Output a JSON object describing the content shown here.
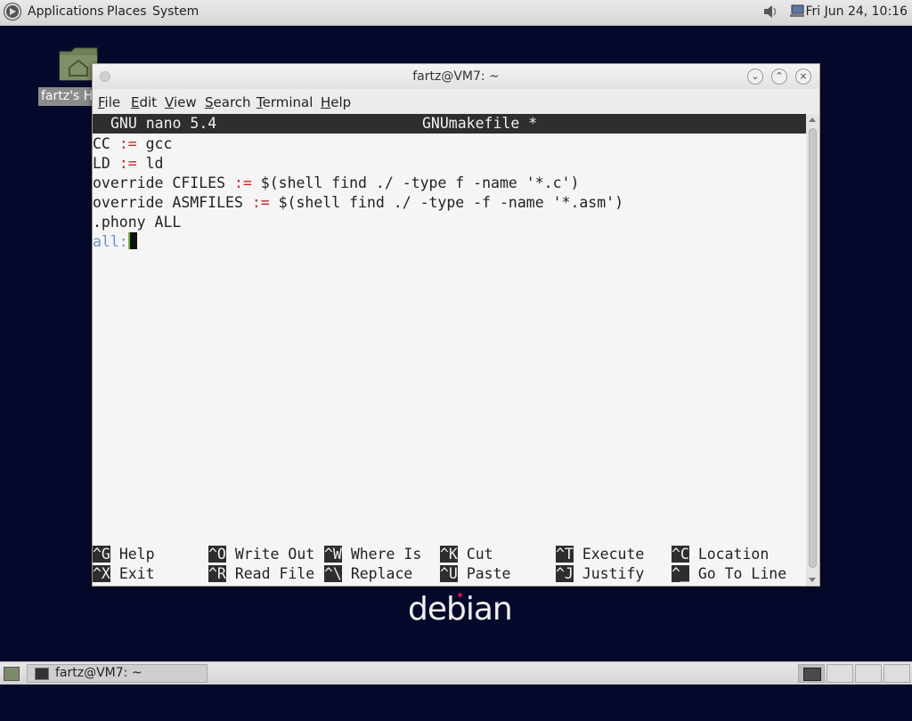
{
  "top_panel": {
    "menus": [
      "Applications",
      "Places",
      "System"
    ],
    "clock": "Fri Jun 24, 10:16",
    "icons": [
      "debian-logo-icon",
      "volume-icon",
      "network-icon"
    ]
  },
  "desktop": {
    "home_icon_label": "fartz's Home",
    "wordmark": "debian"
  },
  "window": {
    "title": "fartz@VM7: ~",
    "menus": [
      {
        "label": "File",
        "mnemonic": "F"
      },
      {
        "label": "Edit",
        "mnemonic": "E"
      },
      {
        "label": "View",
        "mnemonic": "V"
      },
      {
        "label": "Search",
        "mnemonic": "S"
      },
      {
        "label": "Terminal",
        "mnemonic": "T"
      },
      {
        "label": "Help",
        "mnemonic": "H"
      }
    ]
  },
  "nano": {
    "version": "GNU nano 5.4",
    "filename": "GNUmakefile *",
    "lines": [
      {
        "a": "CC ",
        "op": ":=",
        "b": " gcc"
      },
      {
        "a": "LD ",
        "op": ":=",
        "b": " ld"
      },
      {
        "a": "override CFILES ",
        "op": ":=",
        "b": " $(shell find ./ -type f -name '*.c')"
      },
      {
        "a": "override ASMFILES ",
        "op": ":=",
        "b": " $(shell find ./ -type -f -name '*.asm')"
      },
      {
        "a": ".phony ALL",
        "op": "",
        "b": ""
      },
      {
        "a": "all:",
        "op": "",
        "b": ""
      }
    ],
    "shortcuts_row1": [
      {
        "key": "^G",
        "label": "Help"
      },
      {
        "key": "^O",
        "label": "Write Out"
      },
      {
        "key": "^W",
        "label": "Where Is"
      },
      {
        "key": "^K",
        "label": "Cut"
      },
      {
        "key": "^T",
        "label": "Execute"
      },
      {
        "key": "^C",
        "label": "Location"
      }
    ],
    "shortcuts_row2": [
      {
        "key": "^X",
        "label": "Exit"
      },
      {
        "key": "^R",
        "label": "Read File"
      },
      {
        "key": "^\\",
        "label": "Replace"
      },
      {
        "key": "^U",
        "label": "Paste"
      },
      {
        "key": "^J",
        "label": "Justify"
      },
      {
        "key": "^_",
        "label": "Go To Line"
      }
    ]
  },
  "taskbar": {
    "task_label": "fartz@VM7: ~",
    "workspaces": 4
  },
  "colors": {
    "desktop_bg": "#050a2c",
    "operator": "#c4262a",
    "target_label": "#6a95c4",
    "cursor": "#70b533"
  }
}
